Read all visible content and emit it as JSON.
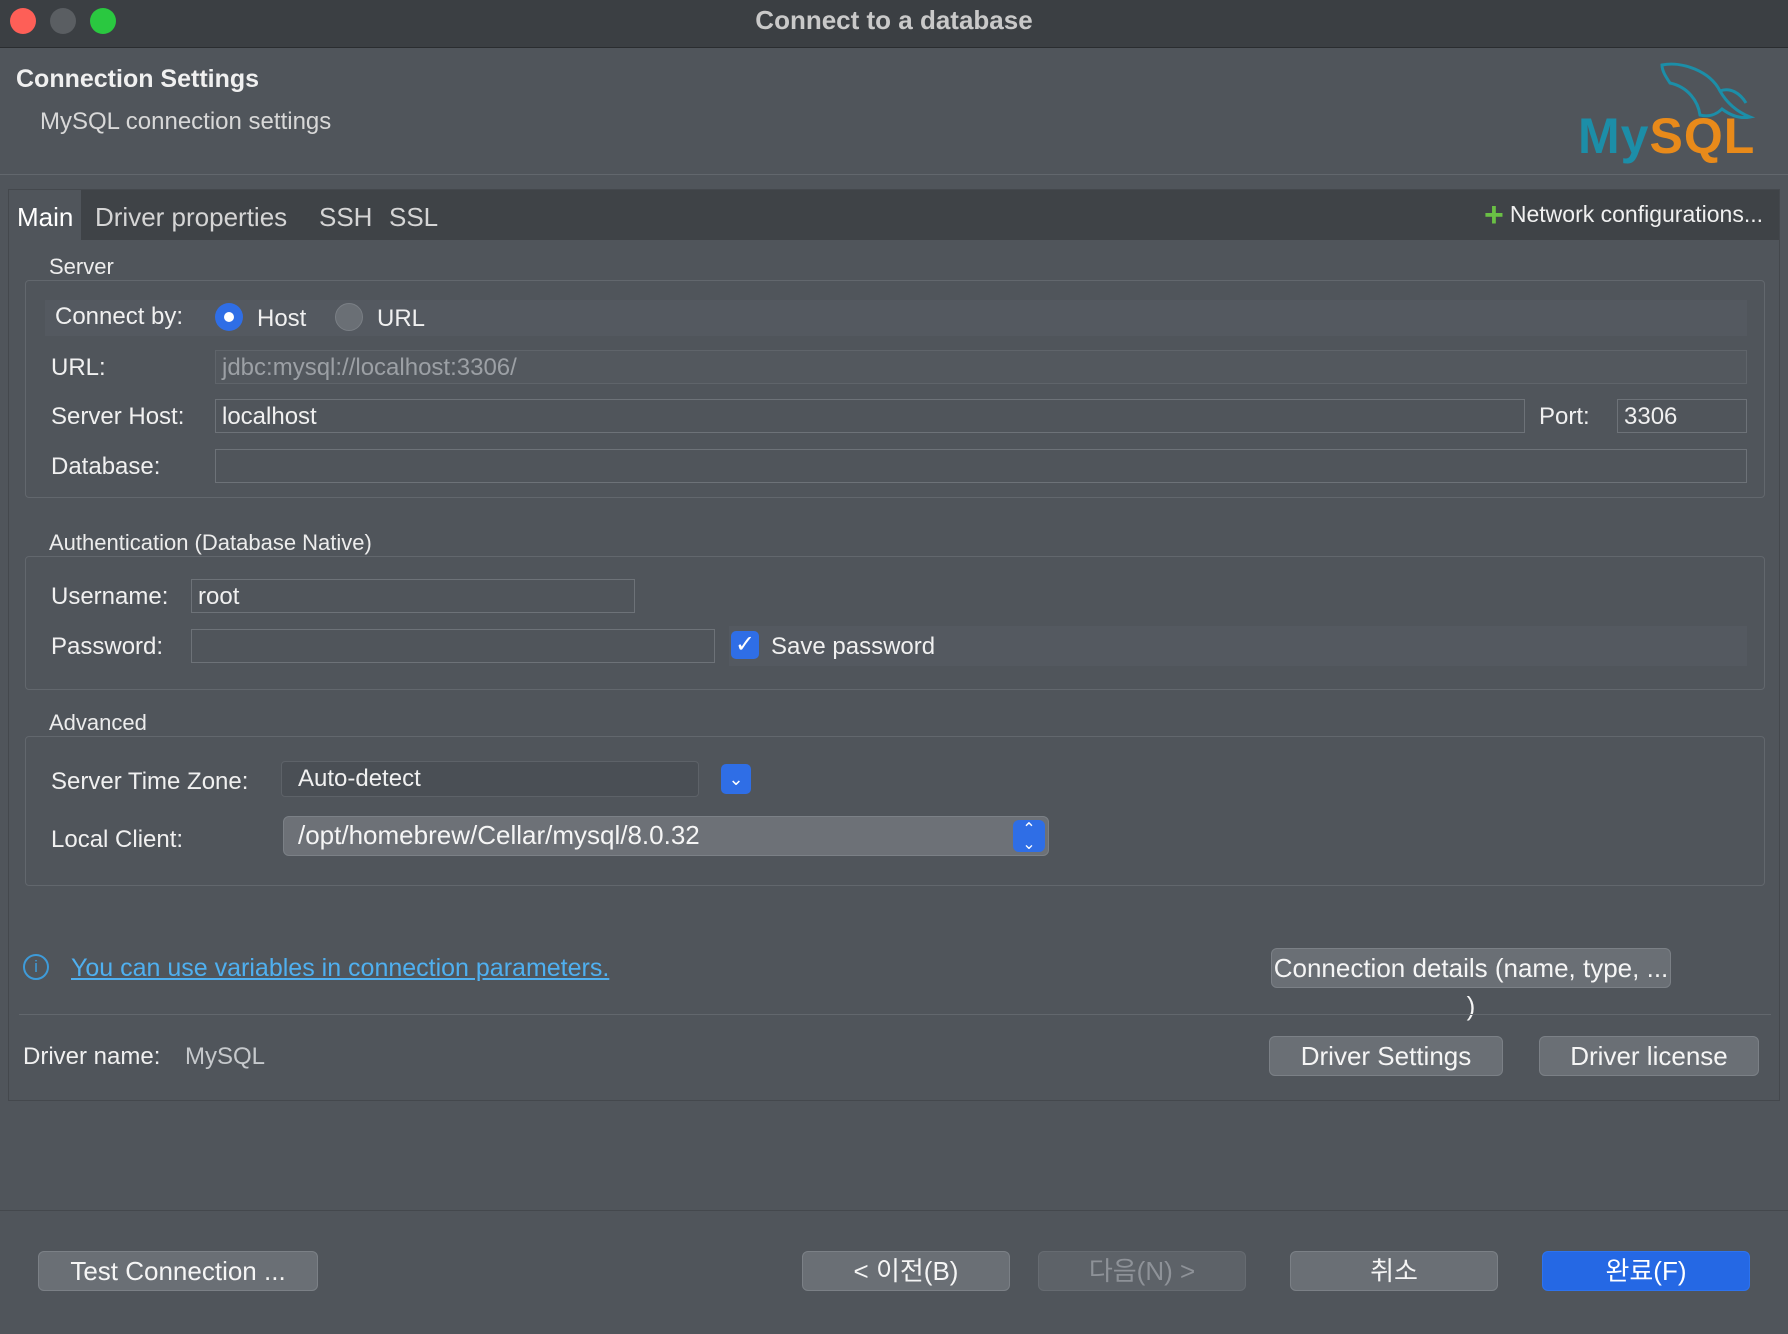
{
  "window": {
    "title": "Connect to a database"
  },
  "header": {
    "title": "Connection Settings",
    "subtitle": "MySQL connection settings",
    "logo_text_my": "My",
    "logo_text_sql": "SQL"
  },
  "tabs": [
    {
      "label": "Main",
      "active": true
    },
    {
      "label": "Driver properties"
    },
    {
      "label": "SSH"
    },
    {
      "label": "SSL"
    }
  ],
  "network_config": {
    "label": "Network configurations..."
  },
  "server": {
    "group_label": "Server",
    "connect_by_label": "Connect by:",
    "connect_by_options": [
      "Host",
      "URL"
    ],
    "connect_by_selected": "Host",
    "url_label": "URL:",
    "url_value": "jdbc:mysql://localhost:3306/",
    "host_label": "Server Host:",
    "host_value": "localhost",
    "port_label": "Port:",
    "port_value": "3306",
    "database_label": "Database:",
    "database_value": ""
  },
  "auth": {
    "group_label": "Authentication (Database Native)",
    "username_label": "Username:",
    "username_value": "root",
    "password_label": "Password:",
    "password_value": "",
    "save_password_label": "Save password",
    "save_password_checked": true
  },
  "advanced": {
    "group_label": "Advanced",
    "timezone_label": "Server Time Zone:",
    "timezone_value": "Auto-detect",
    "local_client_label": "Local Client:",
    "local_client_value": "/opt/homebrew/Cellar/mysql/8.0.32"
  },
  "info": {
    "link_text": "You can use variables in connection parameters.",
    "details_button": "Connection details (name, type, ... )"
  },
  "driver": {
    "label": "Driver name:",
    "value": "MySQL",
    "settings_button": "Driver Settings",
    "license_button": "Driver license"
  },
  "footer": {
    "test_button": "Test Connection ...",
    "back_button": "< 이전(B)",
    "next_button": "다음(N) >",
    "cancel_button": "취소",
    "finish_button": "완료(F)"
  },
  "colors": {
    "accent": "#2f6ee6",
    "link": "#4fb0f0",
    "plus": "#6ac045",
    "mysql_blue": "#1c8ea8",
    "mysql_orange": "#e88a1a"
  }
}
